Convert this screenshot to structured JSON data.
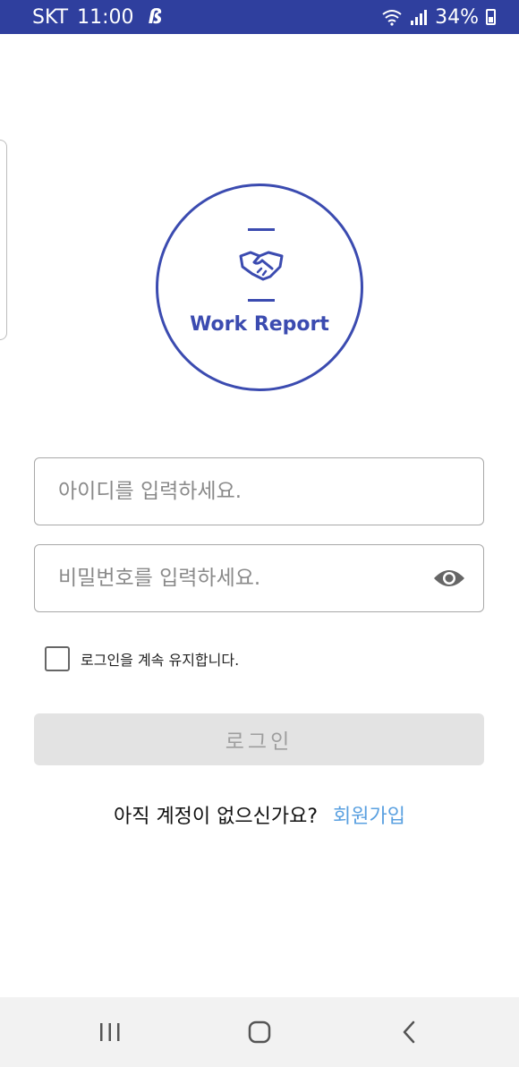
{
  "status_bar": {
    "carrier": "SKT",
    "time": "11:00",
    "battery": "34%",
    "icons": [
      "sync-icon",
      "wifi-icon",
      "signal-icon",
      "battery-icon"
    ]
  },
  "logo": {
    "brand": "Work Report",
    "icon": "handshake-icon",
    "color": "#3b4bb0"
  },
  "form": {
    "id_placeholder": "아이디를 입력하세요.",
    "password_placeholder": "비밀번호를 입력하세요.",
    "keep_login_label": "로그인을 계속 유지합니다.",
    "keep_login_checked": false,
    "login_button": "로그인"
  },
  "signup": {
    "prompt": "아직 계정이 없으신가요?",
    "link": "회원가입",
    "link_color": "#5aa0e0"
  },
  "nav_bar": {
    "buttons": [
      "recent-apps",
      "home",
      "back"
    ]
  }
}
